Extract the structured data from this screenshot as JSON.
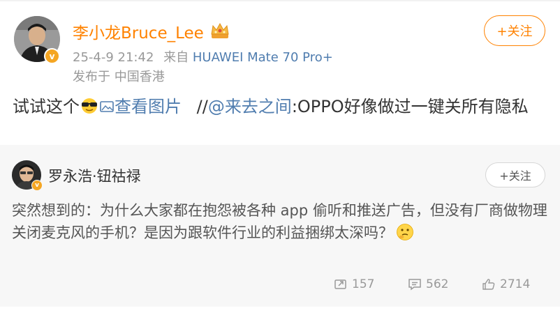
{
  "post": {
    "author": "李小龙Bruce_Lee",
    "timestamp": "25-4-9 21:42",
    "source_prefix": "来自",
    "device": "HUAWEI Mate 70 Pro+",
    "location": "发布于 中国香港",
    "follow_label": "+关注",
    "text_main": "试试这个",
    "view_image_label": "查看图片",
    "repost_sep": "//",
    "repost_user": "@来去之间",
    "repost_text": ":OPPO好像做过一键关所有隐私"
  },
  "retweet": {
    "author": "罗永浩·钮祜禄",
    "follow_label": "+关注",
    "text": "突然想到的：为什么大家都在抱怨被各种 app 偷听和推送广告，但没有厂商做物理关闭麦克风的手机？是因为跟软件行业的利益捆绑太深吗？",
    "reposts": "157",
    "comments": "562",
    "likes": "2714"
  },
  "icons": {
    "verified": "verified-badge-icon",
    "crown": "crown-icon",
    "cool_emoji": "sunglasses-emoji-icon",
    "image": "image-icon",
    "think_emoji": "thinking-emoji-icon",
    "repost": "repost-icon",
    "comment": "comment-icon",
    "like": "thumbs-up-icon"
  },
  "colors": {
    "accent": "#ff8200",
    "link": "#507daf",
    "retweet_bg": "#f7f7f7"
  }
}
